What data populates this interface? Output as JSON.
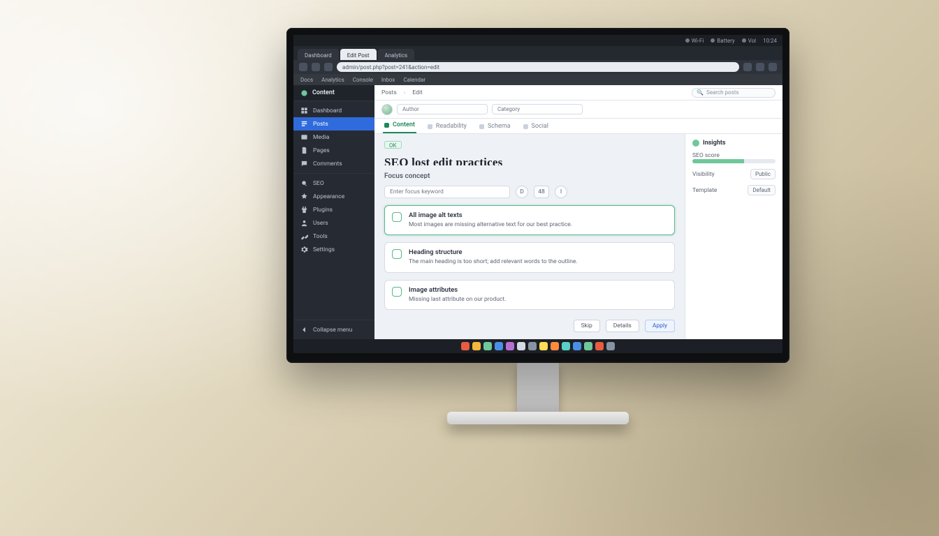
{
  "os": {
    "indicators": [
      "Wi-Fi",
      "Battery",
      "Vol"
    ],
    "time": "10:24"
  },
  "browser": {
    "tabs": [
      {
        "label": "Dashboard"
      },
      {
        "label": "Edit Post",
        "active": true
      },
      {
        "label": "Analytics"
      }
    ],
    "url": "admin/post.php?post=241&action=edit",
    "bookmarks": [
      "Docs",
      "Analytics",
      "Console",
      "Inbox",
      "Calendar"
    ]
  },
  "sidebar": {
    "brand": "Content",
    "groups": [
      {
        "items": [
          {
            "icon": "dashboard",
            "label": "Dashboard"
          },
          {
            "icon": "posts",
            "label": "Posts",
            "active": true
          },
          {
            "icon": "media",
            "label": "Media"
          },
          {
            "icon": "pages",
            "label": "Pages"
          },
          {
            "icon": "comments",
            "label": "Comments"
          }
        ]
      },
      {
        "items": [
          {
            "icon": "seo",
            "label": "SEO"
          },
          {
            "icon": "appearance",
            "label": "Appearance"
          },
          {
            "icon": "plugins",
            "label": "Plugins"
          },
          {
            "icon": "users",
            "label": "Users"
          },
          {
            "icon": "tools",
            "label": "Tools"
          },
          {
            "icon": "settings",
            "label": "Settings"
          }
        ]
      },
      {
        "items": [
          {
            "icon": "collapse",
            "label": "Collapse menu"
          }
        ]
      }
    ]
  },
  "topbar": {
    "crumbs": [
      "Posts",
      "Edit"
    ],
    "search_placeholder": "Search posts"
  },
  "toolrow": {
    "author_field": "Author",
    "category_field": "Category"
  },
  "context_tabs": [
    {
      "label": "Content",
      "active": true
    },
    {
      "label": "Readability"
    },
    {
      "label": "Schema"
    },
    {
      "label": "Social"
    }
  ],
  "editor": {
    "status": "OK",
    "title": "SEO lost edit practices",
    "subtitle": "Focus concept",
    "keyword_placeholder": "Enter focus keyword",
    "metrics": {
      "difficulty": "D",
      "volume": "48",
      "intent": "I"
    },
    "items": [
      {
        "title": "All image alt texts",
        "desc": "Most images are missing alternative text for our best practice."
      },
      {
        "title": "Heading structure",
        "desc": "The main heading is too short; add relevant words to the outline."
      },
      {
        "title": "Image attributes",
        "desc": "Missing last attribute on our product."
      }
    ],
    "actions": {
      "secondary": "Skip",
      "tertiary": "Details",
      "primary": "Apply"
    }
  },
  "inspector": {
    "title": "Insights",
    "score_label": "SEO score",
    "visibility_label": "Visibility",
    "visibility_value": "Public",
    "template_label": "Template",
    "template_value": "Default"
  },
  "colors": {
    "accent": "#1f8a5a",
    "link": "#2f6bdc"
  }
}
